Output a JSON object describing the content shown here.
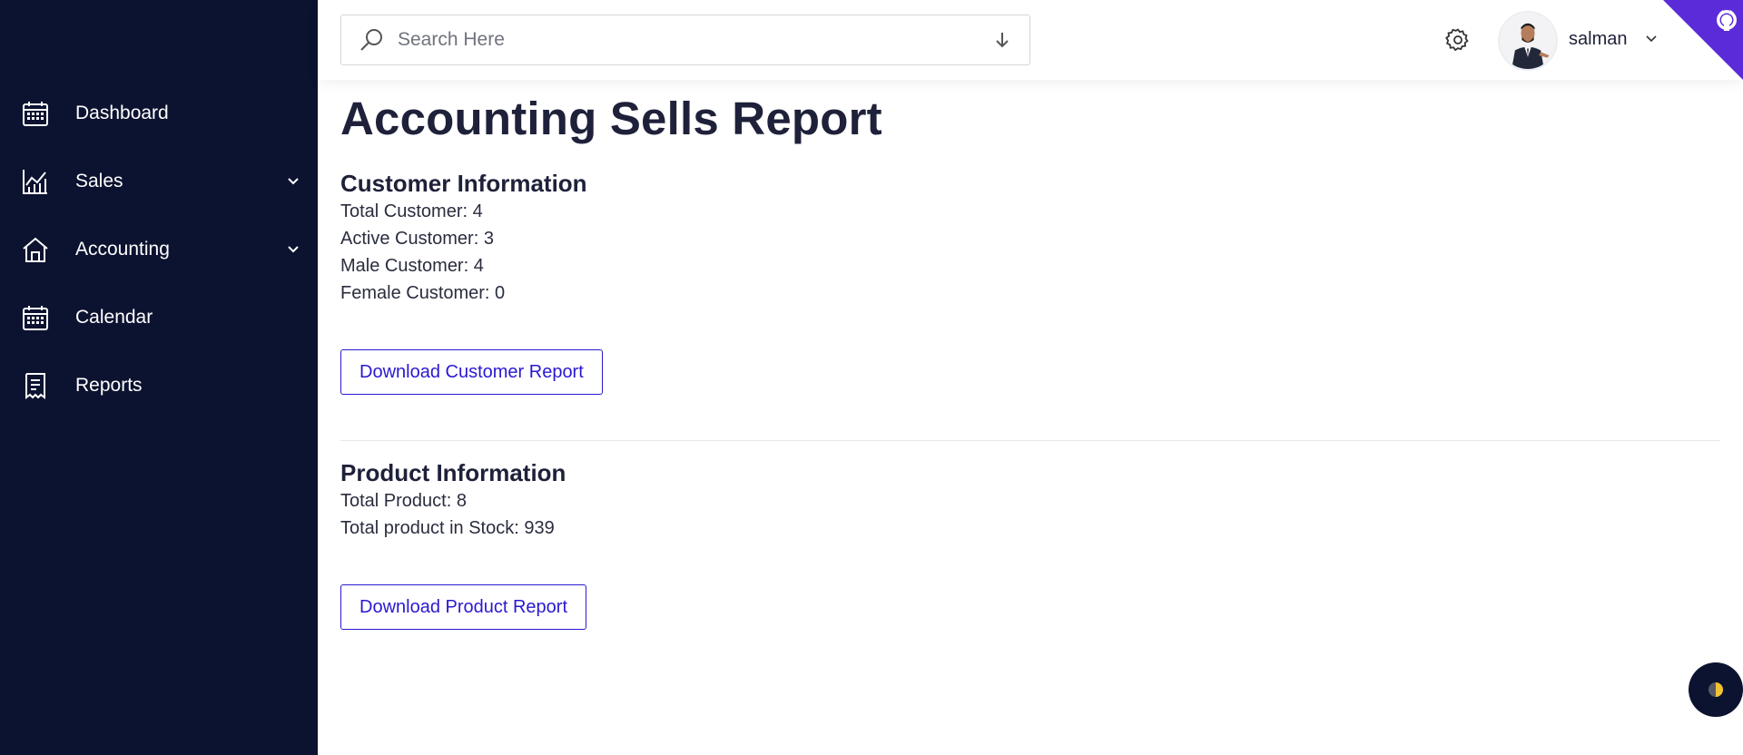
{
  "sidebar": {
    "items": [
      {
        "label": "Dashboard",
        "icon": "calendar-icon",
        "has_chevron": false
      },
      {
        "label": "Sales",
        "icon": "chart-icon",
        "has_chevron": true
      },
      {
        "label": "Accounting",
        "icon": "home-icon",
        "has_chevron": true
      },
      {
        "label": "Calendar",
        "icon": "calendar-icon",
        "has_chevron": false
      },
      {
        "label": "Reports",
        "icon": "receipt-icon",
        "has_chevron": false
      }
    ]
  },
  "header": {
    "search_placeholder": "Search Here",
    "username": "salman"
  },
  "main": {
    "title": "Accounting Sells Report",
    "customer": {
      "heading": "Customer Information",
      "lines": [
        "Total Customer: 4",
        "Active Customer: 3",
        "Male Customer: 4",
        "Female Customer: 0"
      ],
      "button": "Download Customer Report"
    },
    "product": {
      "heading": "Product Information",
      "lines": [
        "Total Product: 8",
        "Total product in Stock: 939"
      ],
      "button": "Download Product Report"
    }
  },
  "colors": {
    "sidebar_bg": "#0c1330",
    "accent": "#2a19d1",
    "corner_banner": "#5b2bd9"
  }
}
